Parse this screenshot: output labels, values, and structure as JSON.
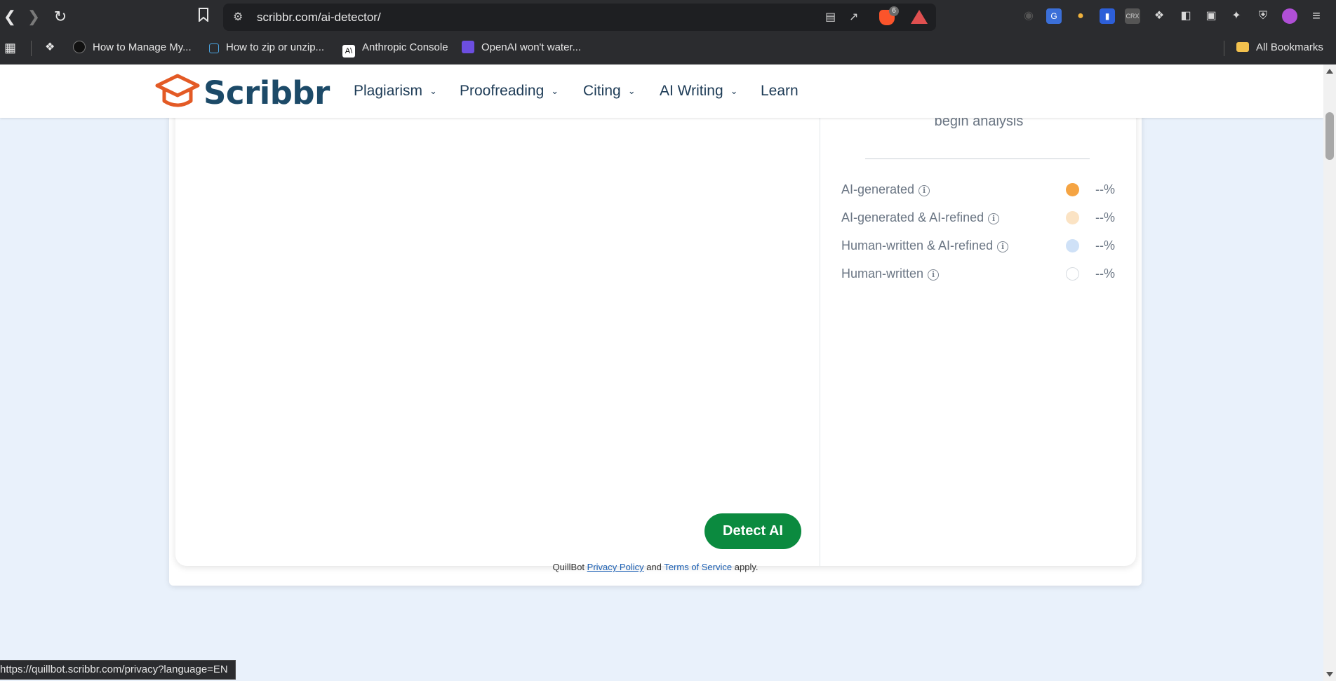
{
  "browser": {
    "url": "scribbr.com/ai-detector/",
    "brave_badge": "6",
    "bookmarks": [
      {
        "label": "How to Manage My..."
      },
      {
        "label": "How to zip or unzip..."
      },
      {
        "label": "Anthropic Console"
      },
      {
        "label": "OpenAI won't water..."
      }
    ],
    "all_bookmarks": "All Bookmarks",
    "status_url": "https://quillbot.scribbr.com/privacy?language=EN"
  },
  "site": {
    "logo_text": "Scribbr",
    "brand_color": "#e35a25",
    "nav": [
      {
        "label": "Plagiarism"
      },
      {
        "label": "Proofreading"
      },
      {
        "label": "Citing"
      },
      {
        "label": "AI Writing"
      },
      {
        "label": "Learn"
      }
    ]
  },
  "detector": {
    "prompt_partial": "begin analysis",
    "detect_button": "Detect AI",
    "results": [
      {
        "label": "AI-generated",
        "value": "--%",
        "color": "#f5a443"
      },
      {
        "label": "AI-generated & AI-refined",
        "value": "--%",
        "color": "#fbe3c4"
      },
      {
        "label": "Human-written & AI-refined",
        "value": "--%",
        "color": "#cfe1f7"
      },
      {
        "label": "Human-written",
        "value": "--%",
        "color": "#ffffff"
      }
    ]
  },
  "footer": {
    "prefix": "QuillBot",
    "privacy": "Privacy Policy",
    "and": "and",
    "terms": "Terms of Service",
    "suffix": "apply."
  }
}
